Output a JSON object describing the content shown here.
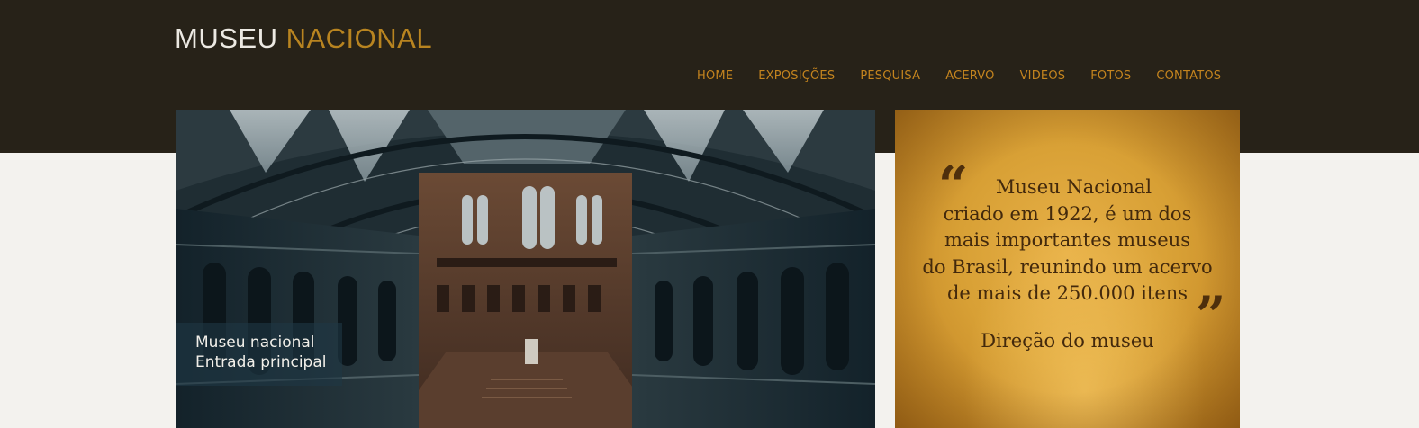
{
  "header": {
    "logo_word1": "MUSEU",
    "logo_word2": "NACIONAL"
  },
  "nav": {
    "items": [
      "HOME",
      "EXPOSIÇÕES",
      "PESQUISA",
      "ACERVO",
      "VIDEOS",
      "FOTOS",
      "CONTATOS"
    ]
  },
  "hero": {
    "caption_line1": "Museu nacional",
    "caption_line2": "Entrada principal"
  },
  "quote": {
    "lines": [
      "Museu Nacional",
      "criado em 1922, é um dos",
      "mais importantes museus",
      "do Brasil, reunindo um acervo",
      "de mais de 250.000 itens"
    ],
    "author": "Direção do museu"
  },
  "colors": {
    "header_bg": "#272218",
    "accent": "#c4841e",
    "page_bg": "#f3f2ee"
  }
}
